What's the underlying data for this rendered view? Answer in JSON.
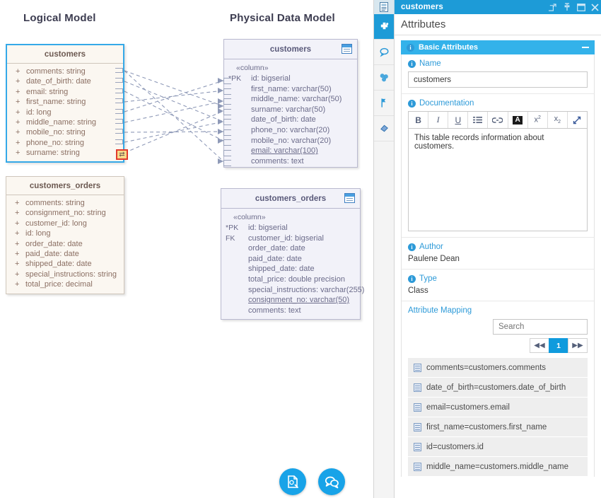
{
  "canvas": {
    "logical_title": "Logical Model",
    "physical_title": "Physical Data Model",
    "logical_tables": [
      {
        "name": "customers",
        "selected": true,
        "attributes": [
          {
            "vis": "+",
            "text": "comments: string"
          },
          {
            "vis": "+",
            "text": "date_of_birth: date"
          },
          {
            "vis": "+",
            "text": "email: string"
          },
          {
            "vis": "+",
            "text": "first_name: string"
          },
          {
            "vis": "+",
            "text": "id: long"
          },
          {
            "vis": "+",
            "text": "middle_name: string"
          },
          {
            "vis": "+",
            "text": "mobile_no: string"
          },
          {
            "vis": "+",
            "text": "phone_no: string"
          },
          {
            "vis": "+",
            "text": "surname: string"
          }
        ]
      },
      {
        "name": "customers_orders",
        "selected": false,
        "attributes": [
          {
            "vis": "+",
            "text": "comments: string"
          },
          {
            "vis": "+",
            "text": "consignment_no: string"
          },
          {
            "vis": "+",
            "text": "customer_id: long"
          },
          {
            "vis": "+",
            "text": "id: long"
          },
          {
            "vis": "+",
            "text": "order_date: date"
          },
          {
            "vis": "+",
            "text": "paid_date: date"
          },
          {
            "vis": "+",
            "text": "shipped_date: date"
          },
          {
            "vis": "+",
            "text": "special_instructions: string"
          },
          {
            "vis": "+",
            "text": "total_price: decimal"
          }
        ]
      }
    ],
    "physical_tables": [
      {
        "name": "customers",
        "stereotype": "«column»",
        "columns": [
          {
            "key": "*PK",
            "text": "id: bigserial",
            "underline": false
          },
          {
            "key": "",
            "text": "first_name: varchar(50)",
            "underline": false
          },
          {
            "key": "",
            "text": "middle_name: varchar(50)",
            "underline": false
          },
          {
            "key": "",
            "text": "surname: varchar(50)",
            "underline": false
          },
          {
            "key": "",
            "text": "date_of_birth: date",
            "underline": false
          },
          {
            "key": "",
            "text": "phone_no: varchar(20)",
            "underline": false
          },
          {
            "key": "",
            "text": "mobile_no: varchar(20)",
            "underline": false
          },
          {
            "key": "",
            "text": "email: varchar(100)",
            "underline": true
          },
          {
            "key": "",
            "text": "comments: text",
            "underline": false
          }
        ]
      },
      {
        "name": "customers_orders",
        "stereotype": "«column»",
        "columns": [
          {
            "key": "*PK",
            "text": "id: bigserial",
            "underline": false
          },
          {
            "key": "FK",
            "text": "customer_id: bigserial",
            "underline": false
          },
          {
            "key": "",
            "text": "order_date: date",
            "underline": false
          },
          {
            "key": "",
            "text": "paid_date: date",
            "underline": false
          },
          {
            "key": "",
            "text": "shipped_date: date",
            "underline": false
          },
          {
            "key": "",
            "text": "total_price: double precision",
            "underline": false
          },
          {
            "key": "",
            "text": "special_instructions: varchar(255)",
            "underline": false
          },
          {
            "key": "",
            "text": "consignment_no: varchar(50)",
            "underline": true
          },
          {
            "key": "",
            "text": "comments: text",
            "underline": false
          }
        ]
      }
    ],
    "fab_buttons": [
      {
        "icon": "document-edit-icon",
        "name": "fab-document-edit"
      },
      {
        "icon": "comments-icon",
        "name": "fab-comments"
      }
    ]
  },
  "panel": {
    "title": "customers",
    "title_icon": "properties-icon",
    "titlebar_actions": [
      {
        "icon": "external-link-icon",
        "name": "open-in-window-button"
      },
      {
        "icon": "pin-icon",
        "name": "pin-button"
      },
      {
        "icon": "maximize-icon",
        "name": "maximize-button"
      },
      {
        "icon": "close-icon",
        "name": "close-button"
      }
    ],
    "rail": [
      {
        "icon": "attributes-icon",
        "name": "rail-attributes",
        "active": true
      },
      {
        "icon": "discussion-icon",
        "name": "rail-discussion",
        "active": false
      },
      {
        "icon": "relations-icon",
        "name": "rail-relations",
        "active": false
      },
      {
        "icon": "tags-icon",
        "name": "rail-tags",
        "active": false
      },
      {
        "icon": "resources-icon",
        "name": "rail-resources",
        "active": false
      }
    ],
    "heading": "Attributes",
    "section": {
      "label": "Basic Attributes",
      "collapsed": false
    },
    "fields": {
      "name_label": "Name",
      "name_value": "customers",
      "documentation_label": "Documentation",
      "documentation_value": "This table records information about customers.",
      "author_label": "Author",
      "author_value": "Paulene Dean",
      "type_label": "Type",
      "type_value": "Class"
    },
    "rte_buttons": [
      {
        "label": "B",
        "name": "bold-button"
      },
      {
        "label": "I",
        "name": "italic-button"
      },
      {
        "label": "U",
        "name": "underline-button"
      },
      {
        "label": "list",
        "name": "list-icon"
      },
      {
        "label": "link",
        "name": "link-icon"
      },
      {
        "label": "A",
        "name": "font-color-icon"
      },
      {
        "label": "sup",
        "name": "superscript-icon"
      },
      {
        "label": "sub",
        "name": "subscript-icon"
      },
      {
        "label": "expand",
        "name": "expand-icon"
      }
    ],
    "attribute_mapping": {
      "label": "Attribute Mapping",
      "search_placeholder": "Search",
      "pager": {
        "first_label": "◀◀",
        "current_page": "1",
        "last_label": "▶▶"
      },
      "rows": [
        "comments=customers.comments",
        "date_of_birth=customers.date_of_birth",
        "email=customers.email",
        "first_name=customers.first_name",
        "id=customers.id",
        "middle_name=customers.middle_name"
      ]
    }
  },
  "colors": {
    "accent_blue": "#1d9bd7",
    "section_blue": "#33b2ea",
    "link_blue": "#2d9ad8",
    "logical_fill": "#fbf7f1",
    "physical_fill": "#f2f2f9",
    "selection_blue": "#35a9e8",
    "anchor_red": "#e23b2e"
  }
}
